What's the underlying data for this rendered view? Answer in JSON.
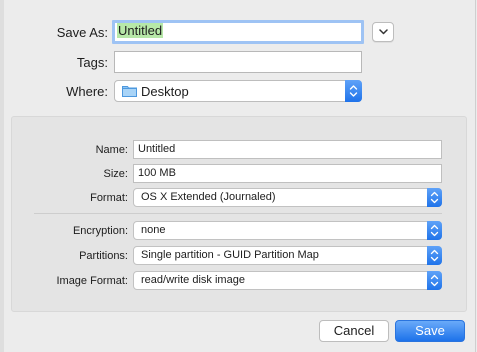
{
  "save_as": {
    "label": "Save As:",
    "value": "Untitled"
  },
  "tags": {
    "label": "Tags:",
    "value": ""
  },
  "where": {
    "label": "Where:",
    "value": "Desktop"
  },
  "image": {
    "name": {
      "label": "Name:",
      "value": "Untitled"
    },
    "size": {
      "label": "Size:",
      "value": "100 MB"
    },
    "format": {
      "label": "Format:",
      "value": "OS X Extended (Journaled)"
    },
    "encryption": {
      "label": "Encryption:",
      "value": "none"
    },
    "partitions": {
      "label": "Partitions:",
      "value": "Single partition - GUID Partition Map"
    },
    "image_format": {
      "label": "Image Format:",
      "value": "read/write disk image"
    }
  },
  "buttons": {
    "cancel": "Cancel",
    "save": "Save"
  },
  "colors": {
    "accent": "#1f73ea",
    "selection": "#b7e8a8",
    "focus_ring": "#9ec3f4"
  },
  "icons": {
    "disclosure": "chevron-down-icon",
    "location": "folder-icon",
    "popup": "up-down-chevron-icon"
  }
}
